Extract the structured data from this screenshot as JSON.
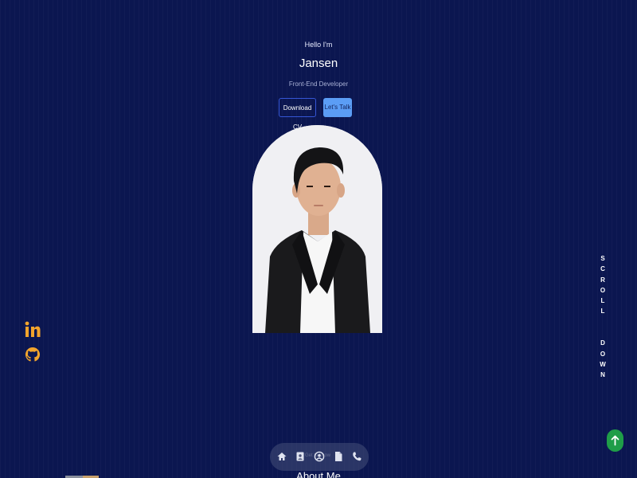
{
  "hero": {
    "greeting": "Hello I'm",
    "name": "Jansen",
    "role": "Front-End Developer",
    "buttons": {
      "download_cv": "Download CV",
      "lets_talk": "Let's Talk"
    }
  },
  "socials": [
    {
      "icon": "linkedin-icon",
      "color": "#f2a42c"
    },
    {
      "icon": "github-icon",
      "color": "#f2a42c"
    }
  ],
  "scroll_down": {
    "label": "S\nC\nR\nO\nL\nL\n\n\nD\nO\nW\nN"
  },
  "nav": {
    "items": [
      "home-icon",
      "contact-card-icon",
      "user-icon",
      "document-icon",
      "phone-icon"
    ],
    "ghost_label": "Get to know"
  },
  "about": {
    "title": "About Me"
  },
  "colors": {
    "background": "#0b1650",
    "primary_button": "#5b9df5",
    "outline_button": "#3556d6",
    "social_accent": "#f2a42c",
    "back_to_top": "#1f9d48"
  }
}
